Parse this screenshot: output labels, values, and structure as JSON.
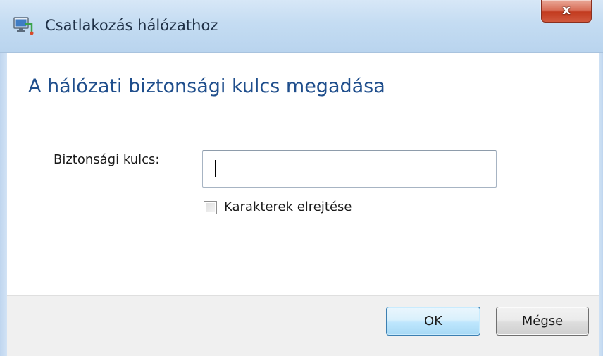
{
  "window": {
    "title": "Csatlakozás hálózathoz",
    "close_glyph": "x",
    "accent_color": "#1f4e8c"
  },
  "dialog": {
    "heading": "A hálózati biztonsági kulcs megadása",
    "key_field": {
      "label": "Biztonsági kulcs:",
      "value": ""
    },
    "hide_chars": {
      "label": "Karakterek elrejtése",
      "checked": false
    }
  },
  "buttons": {
    "ok_label": "OK",
    "cancel_label": "Mégse"
  },
  "icons": {
    "app": "network-connect-icon",
    "close": "close-icon"
  }
}
